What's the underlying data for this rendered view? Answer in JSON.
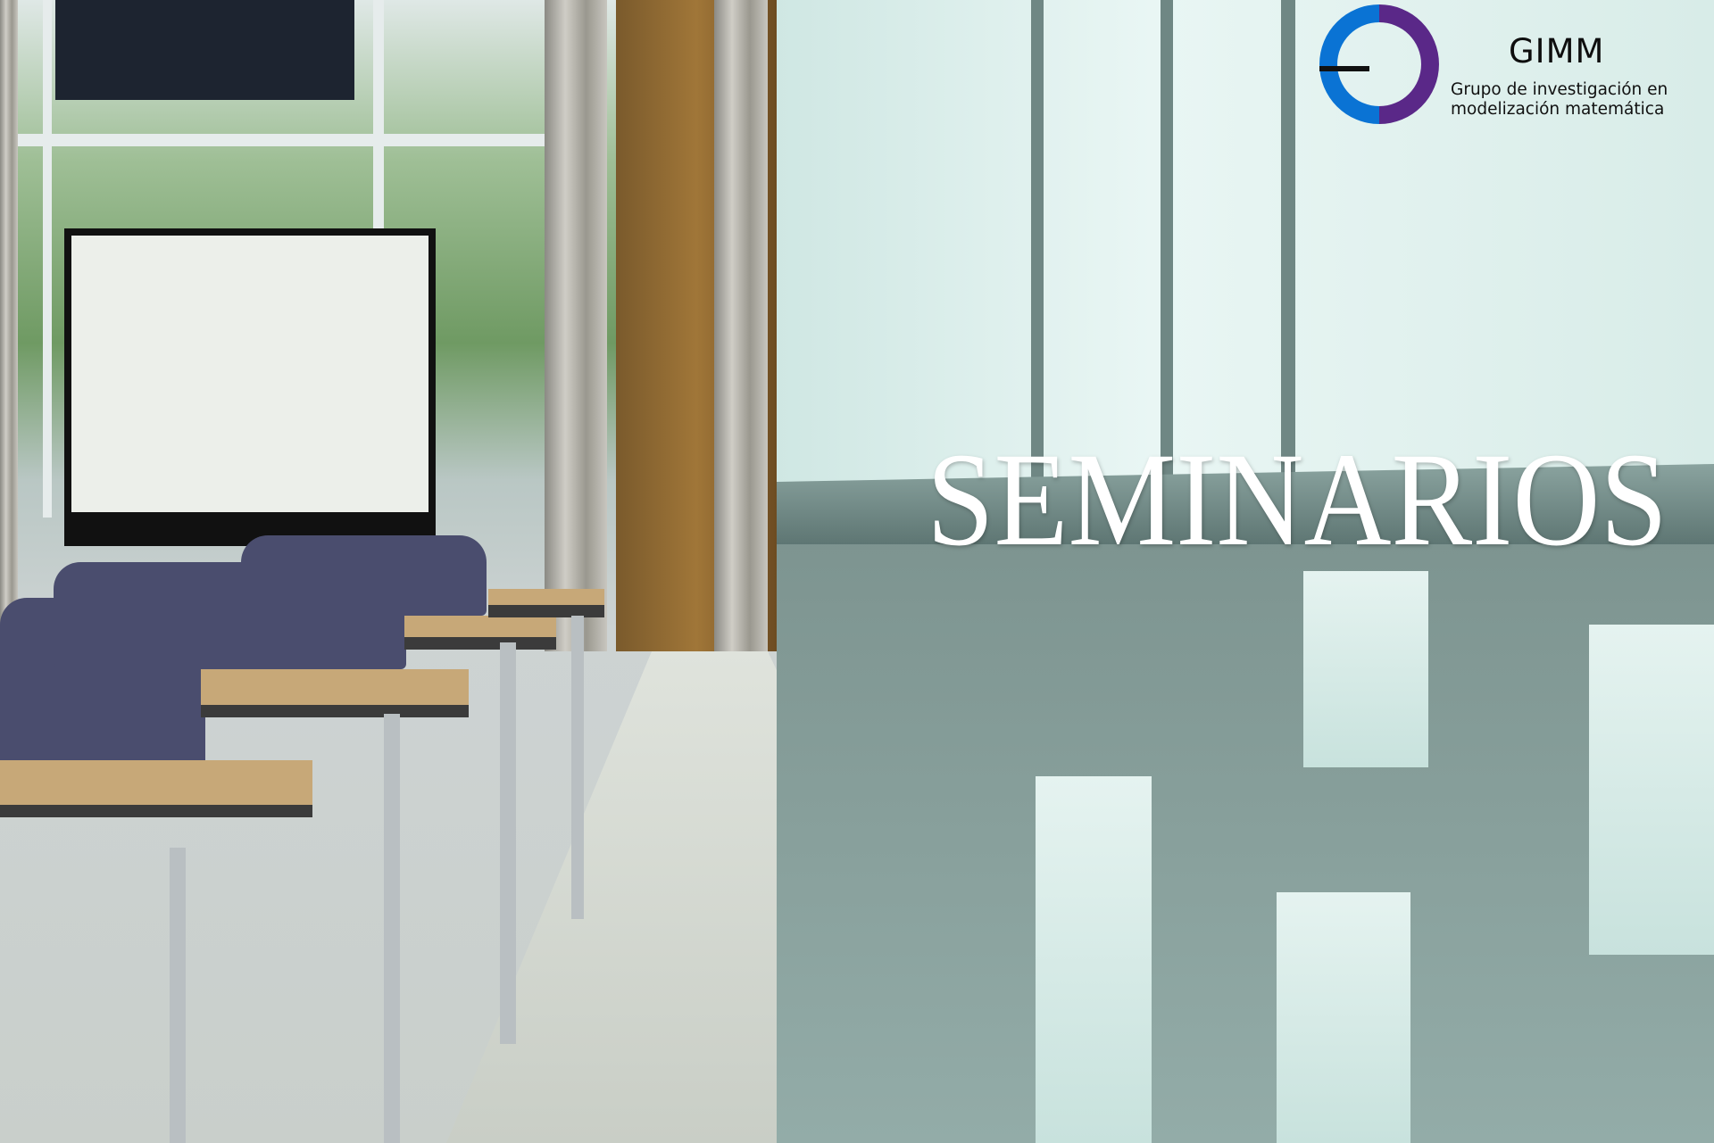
{
  "logo": {
    "name": "GIMM",
    "tagline_line1": "Grupo de investigación en",
    "tagline_line2": "modelización matemática",
    "colors": {
      "left_arc": "#0a73d4",
      "right_arc": "#5a2888",
      "bar": "#111111"
    }
  },
  "banner": {
    "title": "SEMINARIOS",
    "title_color": "#ffffff"
  }
}
